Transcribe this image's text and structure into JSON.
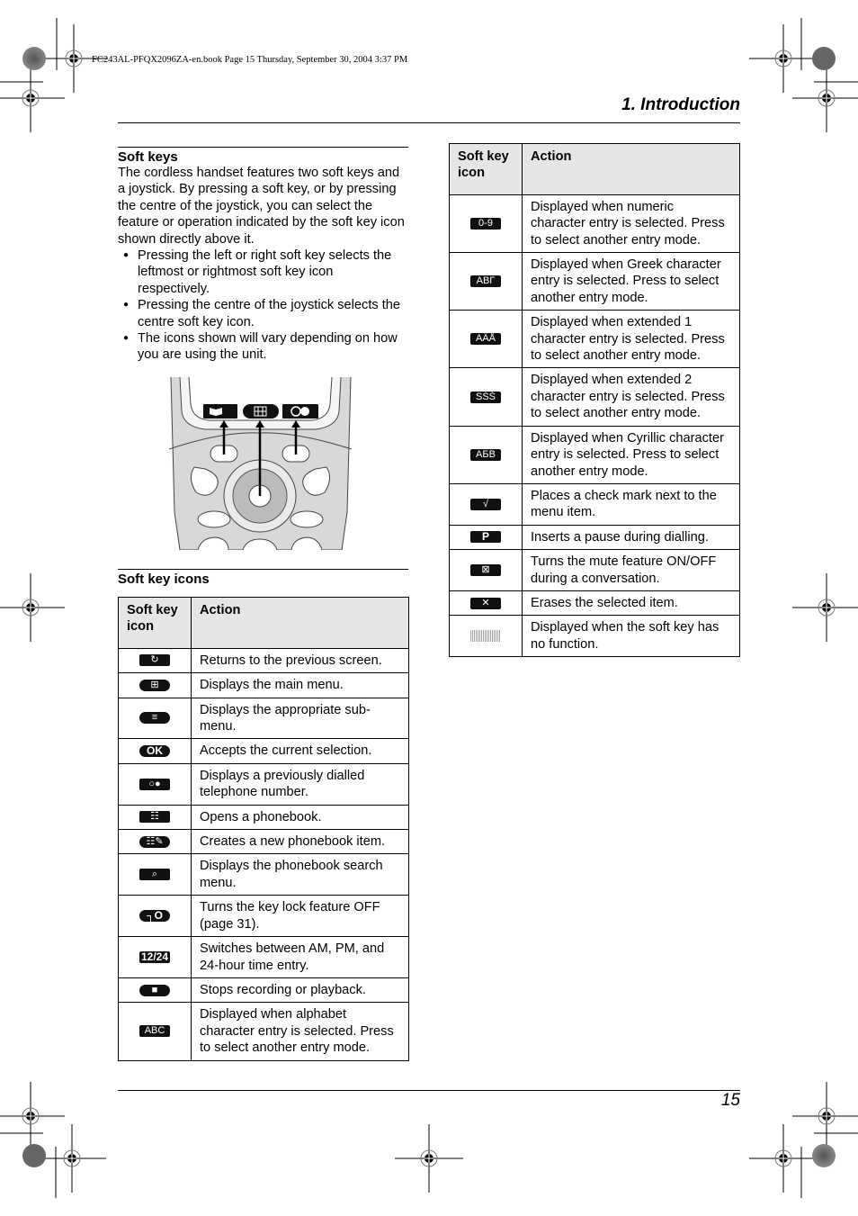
{
  "crop_header": "FC243AL-PFQX2096ZA-en.book  Page 15  Thursday, September 30, 2004  3:37 PM",
  "chapter_title": "1. Introduction",
  "page_number": "15",
  "soft_keys": {
    "title": "Soft keys",
    "intro": "The cordless handset features two soft keys and a joystick. By pressing a soft key, or by pressing the centre of the joystick, you can select the feature or operation indicated by the soft key icon shown directly above it.",
    "bullets": [
      "Pressing the left or right soft key selects the leftmost or rightmost soft key icon respectively.",
      "Pressing the centre of the joystick selects the centre soft key icon.",
      "The icons shown will vary depending on how you are using the unit."
    ],
    "illustration": {
      "icons": [
        "phonebook-icon",
        "main-menu-icon",
        "redial-icon"
      ]
    }
  },
  "soft_key_icons": {
    "title": "Soft key icons",
    "headers": [
      "Soft key icon",
      "Action"
    ],
    "left_rows": [
      {
        "icon": "back-icon",
        "glyph": "↻",
        "style": "",
        "action": "Returns to the previous screen."
      },
      {
        "icon": "main-menu-icon",
        "glyph": "⊞",
        "style": "pill",
        "action": "Displays the main menu."
      },
      {
        "icon": "sub-menu-icon",
        "glyph": "≡",
        "style": "pill",
        "action": "Displays the appropriate sub-menu."
      },
      {
        "icon": "ok-icon",
        "glyph": "OK",
        "style": "pill bold",
        "action": "Accepts the current selection."
      },
      {
        "icon": "redial-icon",
        "glyph": "○●",
        "style": "",
        "action": "Displays a previously dialled telephone number."
      },
      {
        "icon": "phonebook-icon",
        "glyph": "☷",
        "style": "",
        "action": "Opens a phonebook."
      },
      {
        "icon": "new-phonebook-item-icon",
        "glyph": "☷✎",
        "style": "pill",
        "action": "Creates a new phonebook item."
      },
      {
        "icon": "search-icon",
        "glyph": "⌕",
        "style": "",
        "action": "Displays the phonebook search menu."
      },
      {
        "icon": "key-lock-icon",
        "glyph": "┐O",
        "style": "pill bold",
        "action": "Turns the key lock feature OFF (page 31)."
      },
      {
        "icon": "12-24-icon",
        "glyph": "12/24",
        "style": "bold",
        "action": "Switches between AM, PM, and 24-hour time entry."
      },
      {
        "icon": "stop-icon",
        "glyph": "■",
        "style": "pill",
        "action": "Stops recording or playback."
      },
      {
        "icon": "abc-icon",
        "glyph": "ABC",
        "style": "",
        "action": "Displayed when alphabet character entry is selected. Press to select another entry mode."
      }
    ],
    "right_rows": [
      {
        "icon": "numeric-icon",
        "glyph": "0-9",
        "style": "",
        "action": "Displayed when numeric character entry is selected. Press to select another entry mode."
      },
      {
        "icon": "greek-icon",
        "glyph": "ΑΒΓ",
        "style": "",
        "action": "Displayed when Greek character entry is selected. Press to select another entry mode."
      },
      {
        "icon": "extended-1-icon",
        "glyph": "AÄÅ",
        "style": "",
        "action": "Displayed when extended 1 character entry is selected. Press to select another entry mode."
      },
      {
        "icon": "extended-2-icon",
        "glyph": "SŚŠ",
        "style": "",
        "action": "Displayed when extended 2 character entry is selected. Press to select another entry mode."
      },
      {
        "icon": "cyrillic-icon",
        "glyph": "АБВ",
        "style": "",
        "action": "Displayed when Cyrillic character entry is selected. Press to select another entry mode."
      },
      {
        "icon": "check-mark-icon",
        "glyph": "√",
        "style": "",
        "action": "Places a check mark next to the menu item."
      },
      {
        "icon": "pause-icon",
        "glyph": "P",
        "style": "bold",
        "action": "Inserts a pause during dialling."
      },
      {
        "icon": "mute-icon",
        "glyph": "⊠",
        "style": "",
        "action": "Turns the mute feature ON/OFF during a conversation."
      },
      {
        "icon": "erase-icon",
        "glyph": "✕",
        "style": "",
        "action": "Erases the selected item."
      },
      {
        "icon": "no-function-icon",
        "glyph": "",
        "style": "none",
        "action": "Displayed when the soft key has no function."
      }
    ]
  }
}
